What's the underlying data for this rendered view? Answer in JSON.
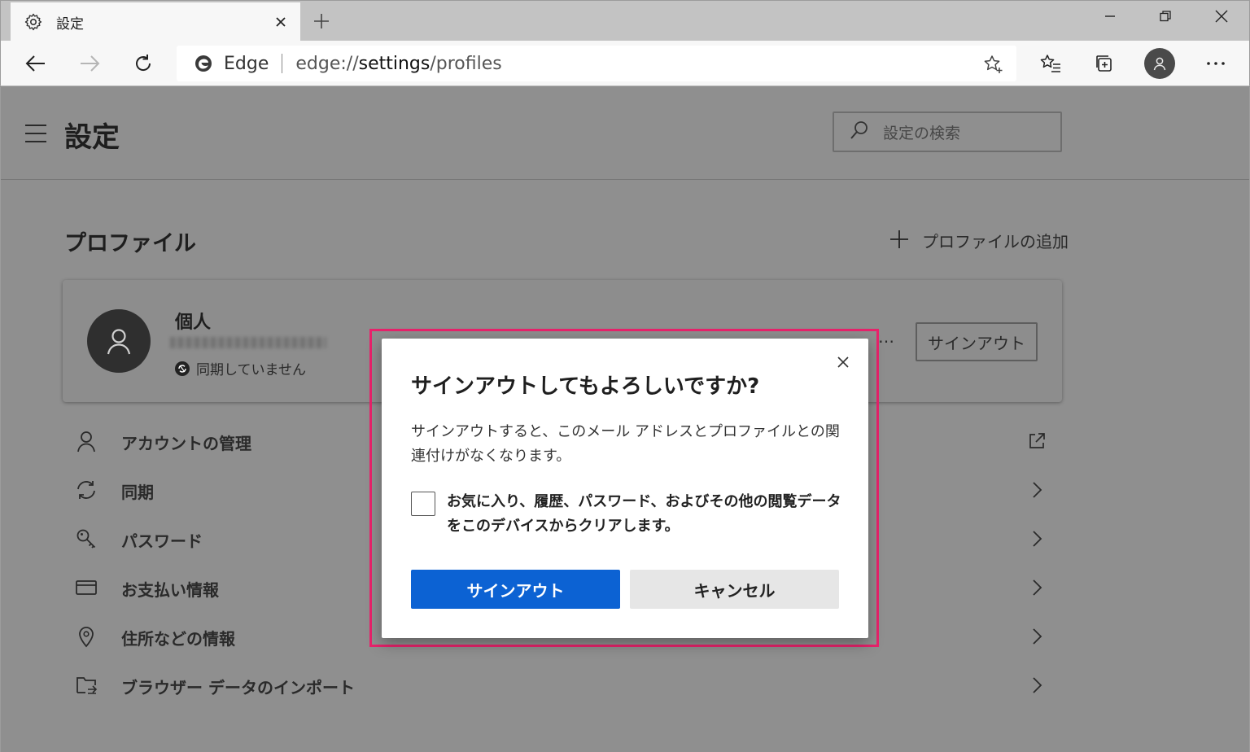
{
  "browser": {
    "tab_title": "設定",
    "address_brand": "Edge",
    "address_url_prefix": "edge://",
    "address_url_host": "settings",
    "address_url_path": "/profiles"
  },
  "settings": {
    "title": "設定",
    "search_placeholder": "設定の検索",
    "section_title": "プロファイル",
    "add_profile_label": "プロファイルの追加",
    "profile": {
      "name": "個人",
      "sync_status": "同期していません",
      "signout_label": "サインアウト",
      "more_label": "…"
    },
    "menu_items": [
      {
        "label": "アカウントの管理",
        "icon": "person-icon",
        "trailing": "external-link-icon"
      },
      {
        "label": "同期",
        "icon": "sync-icon",
        "trailing": "chevron-right-icon"
      },
      {
        "label": "パスワード",
        "icon": "key-icon",
        "trailing": "chevron-right-icon"
      },
      {
        "label": "お支払い情報",
        "icon": "card-icon",
        "trailing": "chevron-right-icon"
      },
      {
        "label": "住所などの情報",
        "icon": "location-pin-icon",
        "trailing": "chevron-right-icon"
      },
      {
        "label": "ブラウザー データのインポート",
        "icon": "import-icon",
        "trailing": "chevron-right-icon"
      }
    ]
  },
  "dialog": {
    "title": "サインアウトしてもよろしいですか?",
    "body": "サインアウトすると、このメール アドレスとプロファイルとの関連付けがなくなります。",
    "checkbox_label": "お気に入り、履歴、パスワード、およびその他の閲覧データをこのデバイスからクリアします。",
    "checkbox_checked": false,
    "confirm_label": "サインアウト",
    "cancel_label": "キャンセル"
  },
  "colors": {
    "primary_button": "#0c62d3",
    "highlight_border": "#e8226b",
    "overlay": "#8f8f8f"
  }
}
